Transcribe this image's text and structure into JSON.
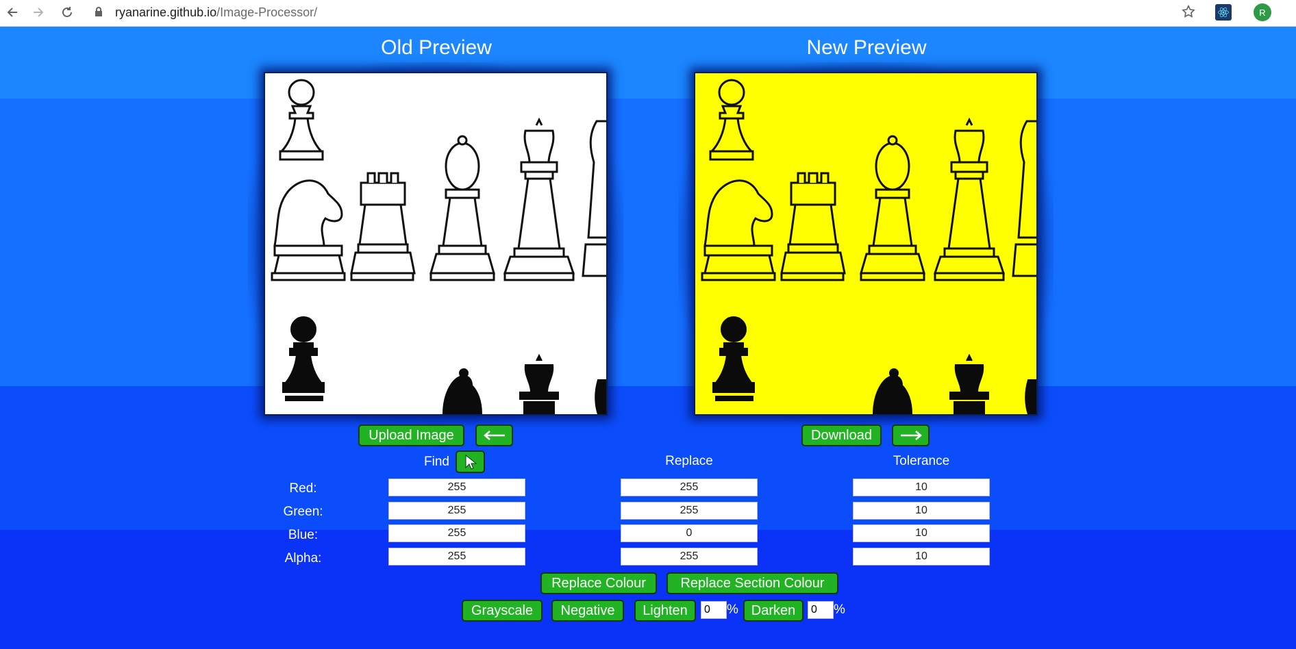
{
  "browser": {
    "url_host": "ryanarine.github.io",
    "url_path": "/Image-Processor/",
    "avatar_letter": "R"
  },
  "previews": {
    "old_title": "Old Preview",
    "new_title": "New Preview"
  },
  "buttons": {
    "upload": "Upload Image",
    "download": "Download",
    "find": "Find",
    "replace_colour": "Replace Colour",
    "replace_section": "Replace Section Colour",
    "grayscale": "Grayscale",
    "negative": "Negative",
    "lighten": "Lighten",
    "darken": "Darken"
  },
  "columns": {
    "replace": "Replace",
    "tolerance": "Tolerance"
  },
  "rows": [
    {
      "label": "Red:",
      "find": "255",
      "replace": "255",
      "tolerance": "10"
    },
    {
      "label": "Green:",
      "find": "255",
      "replace": "255",
      "tolerance": "10"
    },
    {
      "label": "Blue:",
      "find": "255",
      "replace": "0",
      "tolerance": "10"
    },
    {
      "label": "Alpha:",
      "find": "255",
      "replace": "255",
      "tolerance": "10"
    }
  ],
  "adjust": {
    "lighten_value": "0",
    "darken_value": "0",
    "percent": "%"
  },
  "colors": {
    "old_bg": "#ffffff",
    "new_bg": "#ffff00",
    "button_green": "#22b324"
  }
}
